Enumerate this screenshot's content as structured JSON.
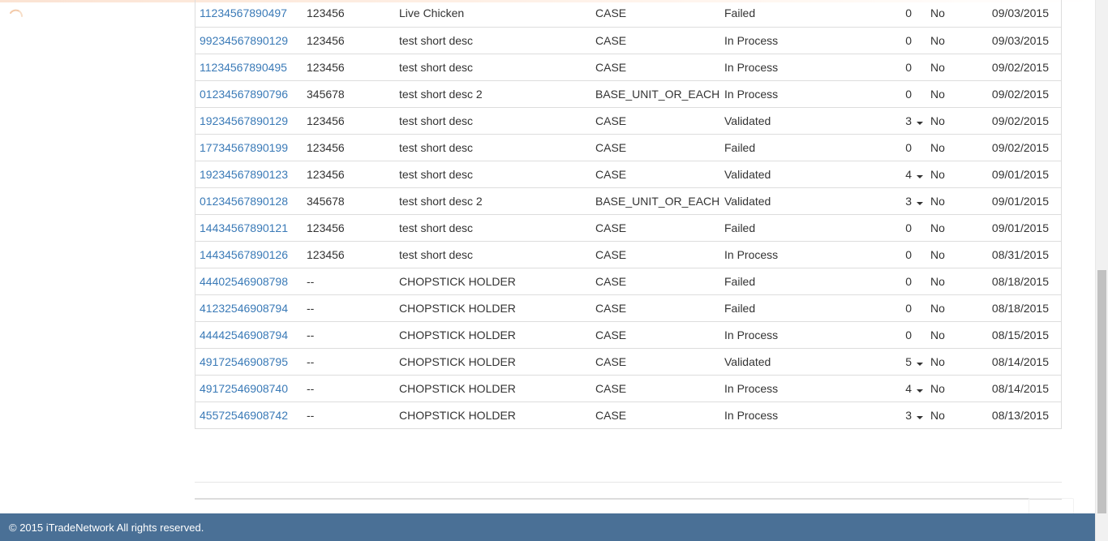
{
  "icons": {
    "loading": "loading-spinner-icon",
    "expand": "caret-down-icon"
  },
  "colors": {
    "link": "#3a7ab7",
    "footer_bg": "#4a7096",
    "border": "#dddddd"
  },
  "table": {
    "rows": [
      {
        "gtin": "11234567890497",
        "code": "123456",
        "description": "Live Chicken",
        "uom": "CASE",
        "status": "Failed",
        "count": "0",
        "has_dropdown": false,
        "flag": "No",
        "date": "09/03/2015"
      },
      {
        "gtin": "99234567890129",
        "code": "123456",
        "description": "test short desc",
        "uom": "CASE",
        "status": "In Process",
        "count": "0",
        "has_dropdown": false,
        "flag": "No",
        "date": "09/03/2015"
      },
      {
        "gtin": "11234567890495",
        "code": "123456",
        "description": "test short desc",
        "uom": "CASE",
        "status": "In Process",
        "count": "0",
        "has_dropdown": false,
        "flag": "No",
        "date": "09/02/2015"
      },
      {
        "gtin": "01234567890796",
        "code": "345678",
        "description": "test short desc 2",
        "uom": "BASE_UNIT_OR_EACH",
        "status": "In Process",
        "count": "0",
        "has_dropdown": false,
        "flag": "No",
        "date": "09/02/2015"
      },
      {
        "gtin": "19234567890129",
        "code": "123456",
        "description": "test short desc",
        "uom": "CASE",
        "status": "Validated",
        "count": "3",
        "has_dropdown": true,
        "flag": "No",
        "date": "09/02/2015"
      },
      {
        "gtin": "17734567890199",
        "code": "123456",
        "description": "test short desc",
        "uom": "CASE",
        "status": "Failed",
        "count": "0",
        "has_dropdown": false,
        "flag": "No",
        "date": "09/02/2015"
      },
      {
        "gtin": "19234567890123",
        "code": "123456",
        "description": "test short desc",
        "uom": "CASE",
        "status": "Validated",
        "count": "4",
        "has_dropdown": true,
        "flag": "No",
        "date": "09/01/2015"
      },
      {
        "gtin": "01234567890128",
        "code": "345678",
        "description": "test short desc 2",
        "uom": "BASE_UNIT_OR_EACH",
        "status": "Validated",
        "count": "3",
        "has_dropdown": true,
        "flag": "No",
        "date": "09/01/2015"
      },
      {
        "gtin": "14434567890121",
        "code": "123456",
        "description": "test short desc",
        "uom": "CASE",
        "status": "Failed",
        "count": "0",
        "has_dropdown": false,
        "flag": "No",
        "date": "09/01/2015"
      },
      {
        "gtin": "14434567890126",
        "code": "123456",
        "description": "test short desc",
        "uom": "CASE",
        "status": "In Process",
        "count": "0",
        "has_dropdown": false,
        "flag": "No",
        "date": "08/31/2015"
      },
      {
        "gtin": "44402546908798",
        "code": "--",
        "description": "CHOPSTICK HOLDER",
        "uom": "CASE",
        "status": "Failed",
        "count": "0",
        "has_dropdown": false,
        "flag": "No",
        "date": "08/18/2015"
      },
      {
        "gtin": "41232546908794",
        "code": "--",
        "description": "CHOPSTICK HOLDER",
        "uom": "CASE",
        "status": "Failed",
        "count": "0",
        "has_dropdown": false,
        "flag": "No",
        "date": "08/18/2015"
      },
      {
        "gtin": "44442546908794",
        "code": "--",
        "description": "CHOPSTICK HOLDER",
        "uom": "CASE",
        "status": "In Process",
        "count": "0",
        "has_dropdown": false,
        "flag": "No",
        "date": "08/15/2015"
      },
      {
        "gtin": "49172546908795",
        "code": "--",
        "description": "CHOPSTICK HOLDER",
        "uom": "CASE",
        "status": "Validated",
        "count": "5",
        "has_dropdown": true,
        "flag": "No",
        "date": "08/14/2015"
      },
      {
        "gtin": "49172546908740",
        "code": "--",
        "description": "CHOPSTICK HOLDER",
        "uom": "CASE",
        "status": "In Process",
        "count": "4",
        "has_dropdown": true,
        "flag": "No",
        "date": "08/14/2015"
      },
      {
        "gtin": "45572546908742",
        "code": "--",
        "description": "CHOPSTICK HOLDER",
        "uom": "CASE",
        "status": "In Process",
        "count": "3",
        "has_dropdown": true,
        "flag": "No",
        "date": "08/13/2015"
      }
    ]
  },
  "footer": {
    "copyright": "© 2015 iTradeNetwork All rights reserved."
  }
}
